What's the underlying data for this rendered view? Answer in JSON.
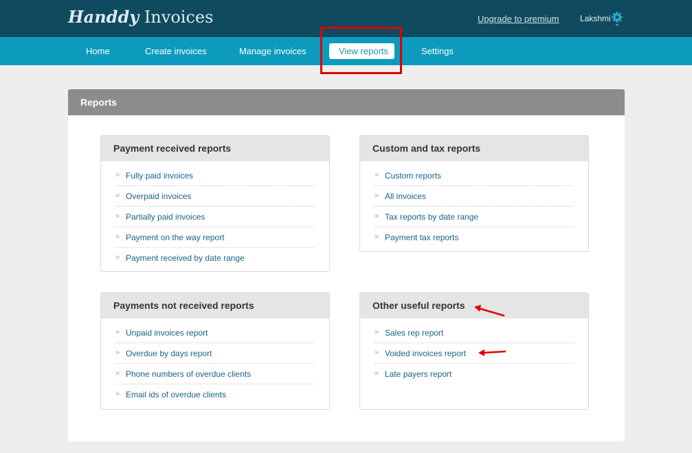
{
  "app": {
    "logo_script": "Handdy",
    "logo_rest": " Invoices"
  },
  "header": {
    "upgrade_label": "Upgrade to premium",
    "username": "Lakshmi",
    "settings_icon": "gear-icon"
  },
  "nav": {
    "items": [
      {
        "label": "Home"
      },
      {
        "label": "Create invoices"
      },
      {
        "label": "Manage invoices"
      },
      {
        "label": "View reports",
        "active": true
      },
      {
        "label": "Settings"
      }
    ]
  },
  "panel": {
    "title": "Reports"
  },
  "cards": [
    {
      "title": "Payment received reports",
      "items": [
        "Fully paid invoices",
        "Overpaid invoices",
        "Partially paid invoices",
        "Payment on the way report",
        "Payment received by date range"
      ]
    },
    {
      "title": "Custom and tax reports",
      "items": [
        "Custom reports",
        "All invoices",
        "Tax reports by date range",
        "Payment tax reports"
      ]
    },
    {
      "title": "Payments not received reports",
      "items": [
        "Unpaid invoices report",
        "Overdue by days report",
        "Phone numbers of overdue clients",
        "Email ids of overdue clients"
      ]
    },
    {
      "title": "Other useful reports",
      "items": [
        "Sales rep report",
        "Voided invoices report",
        "Late payers report"
      ]
    }
  ],
  "colors": {
    "topbar": "#0f4a5f",
    "navbar": "#0c9bbd",
    "annotation": "#e00000",
    "link": "#1a5f8a"
  },
  "icons": {
    "list_bullet": "chevron-right-icon",
    "annotation_arrow": "arrow-left-icon"
  }
}
